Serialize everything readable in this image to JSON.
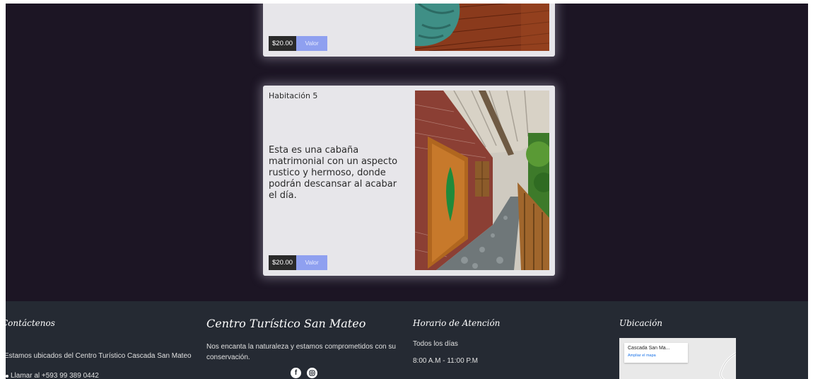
{
  "room_prev": {
    "price": "$20.00",
    "value_label": "Valor"
  },
  "room5": {
    "title": "Habitación 5",
    "description": "Esta es una cabaña matrimonial con un aspecto rustico y hermoso, donde podrán descansar al acabar el día.",
    "price": "$20.00",
    "value_label": "Valor"
  },
  "footer": {
    "contact": {
      "title": "Contáctenos",
      "address": "Estamos ubicados del Centro Turístico Cascada San Mateo",
      "phone": "Llamar al +593 99 389 0442"
    },
    "brand": {
      "title": "Centro Turístico San Mateo",
      "tagline": "Nos encanta la naturaleza y estamos comprometidos con su conservación."
    },
    "hours": {
      "title": "Horario de Atención",
      "days": "Todos los días",
      "time": "8:00 A.M - 11:00 P.M"
    },
    "location": {
      "title": "Ubicación",
      "map_place": "Cascada San Ma...",
      "map_link": "Ampliar el mapa"
    }
  },
  "colors": {
    "page_bg": "#1c1524",
    "card_bg": "#e7e6ea",
    "value_button": "#8fa0f0",
    "footer_bg": "#252a33"
  }
}
